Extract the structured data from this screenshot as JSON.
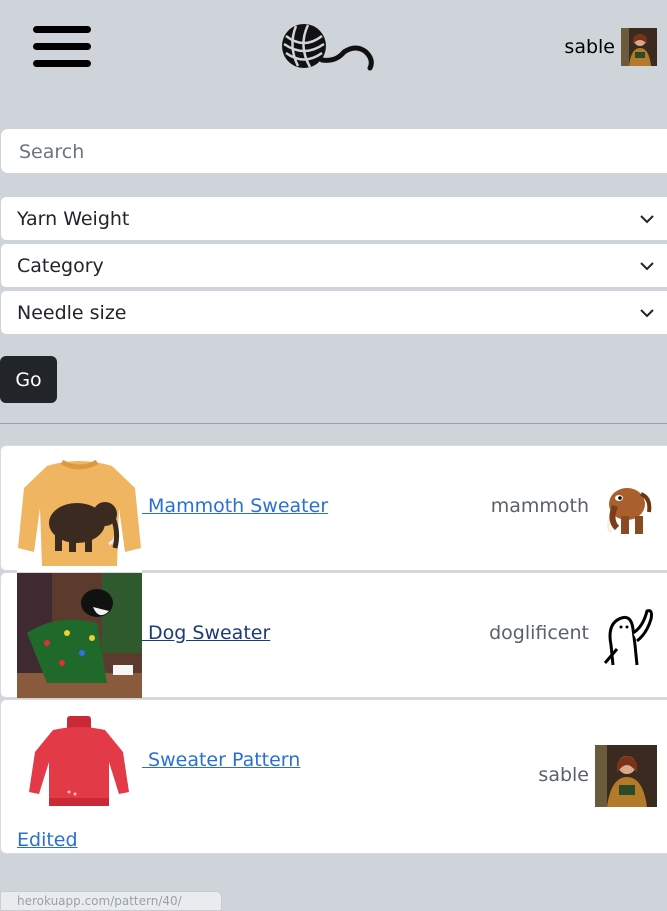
{
  "header": {
    "user_name": "sable",
    "icons": {
      "menu": "hamburger-icon",
      "logo": "yarn-ball-logo"
    }
  },
  "search": {
    "placeholder": "Search",
    "value": ""
  },
  "filters": [
    {
      "label": "Yarn Weight"
    },
    {
      "label": "Category"
    },
    {
      "label": "Needle size"
    }
  ],
  "go_label": "Go",
  "patterns": [
    {
      "title": " Mammoth Sweater",
      "author": "mammoth",
      "edited": ""
    },
    {
      "title": " Dog Sweater",
      "author": "doglificent",
      "edited": ""
    },
    {
      "title": " Sweater Pattern",
      "author": "sable",
      "edited": "Edited"
    }
  ],
  "status_url": "herokuapp.com/pattern/40/",
  "colors": {
    "background": "#cfd4db",
    "link": "#2a6fd6",
    "button": "#212529"
  }
}
